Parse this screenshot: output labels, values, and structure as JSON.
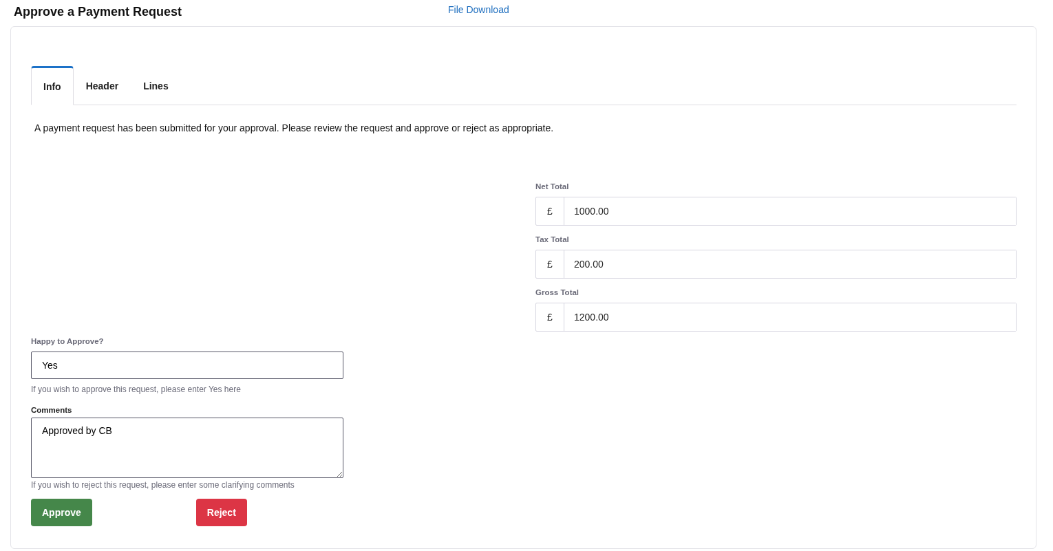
{
  "page": {
    "title": "Approve a Payment Request",
    "link": "File Download"
  },
  "tabs": [
    {
      "label": "Info",
      "selected": true
    },
    {
      "label": "Header",
      "selected": false
    },
    {
      "label": "Lines",
      "selected": false
    }
  ],
  "intro": "A payment request has been submitted for your approval. Please review the request and approve or reject as appropriate.",
  "totals": [
    {
      "label": "Net Total",
      "prefix": "£",
      "value": "1000.00"
    },
    {
      "label": "Tax Total",
      "prefix": "£",
      "value": "200.00"
    },
    {
      "label": "Gross Total",
      "prefix": "£",
      "value": "1200.00"
    }
  ],
  "approve_field": {
    "label": "Happy to Approve?",
    "value": "Yes",
    "help": "If you wish to approve this request, please enter Yes here"
  },
  "comments_field": {
    "label": "Comments",
    "value": "Approved by CB",
    "help": "If you wish to reject this request, please enter some clarifying comments"
  },
  "buttons": [
    {
      "label": "Approve",
      "kind": "approve"
    },
    {
      "label": "Reject",
      "kind": "reject"
    }
  ]
}
